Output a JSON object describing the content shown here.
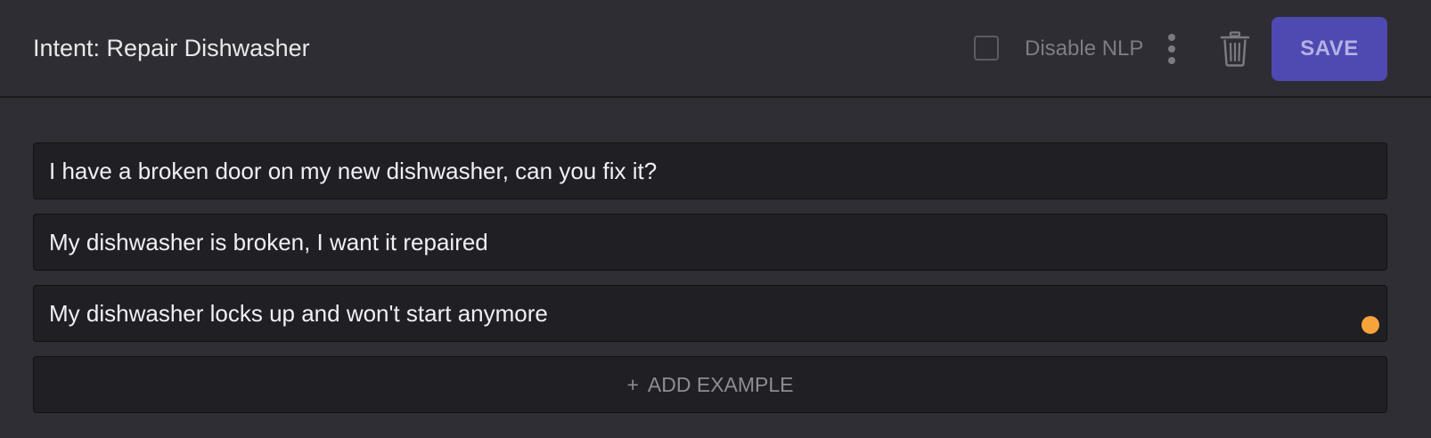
{
  "header": {
    "title": "Intent: Repair Dishwasher",
    "disable_nlp_label": "Disable NLP",
    "disable_nlp_checked": false,
    "more_icon": "vertical-ellipsis-icon",
    "delete_icon": "trash-icon",
    "save_label": "SAVE"
  },
  "examples": [
    {
      "text": "I have a broken door on my new dishwasher, can you fix it?"
    },
    {
      "text": "My dishwasher is broken, I want it repaired"
    },
    {
      "text": "My dishwasher locks up and won't start anymore",
      "status": "unsaved"
    }
  ],
  "add_example": {
    "icon": "+",
    "label": "ADD EXAMPLE"
  },
  "colors": {
    "background": "#2f2e35",
    "save_button": "#4e4ab2",
    "status_dot": "#f5a33a"
  }
}
